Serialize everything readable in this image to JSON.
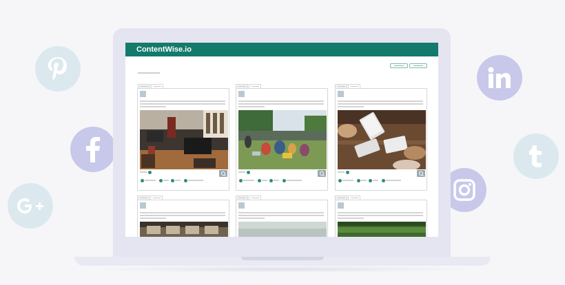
{
  "app": {
    "brand": "ContentWise.io"
  },
  "social_icons": [
    "pinterest-icon",
    "facebook-icon",
    "google-plus-icon",
    "linkedin-icon",
    "tumblr-icon",
    "instagram-icon"
  ],
  "colors": {
    "brand_green": "#147a6b",
    "bubble_blue": "#dbe9ef",
    "bubble_violet": "#c8c8ea"
  },
  "cards": [
    {
      "image": "office-photo"
    },
    {
      "image": "festival-crowd-photo"
    },
    {
      "image": "phones-on-table-photo"
    },
    {
      "image": "sofa-photo"
    },
    {
      "image": "landscape-photo"
    },
    {
      "image": "hedge-photo"
    }
  ]
}
